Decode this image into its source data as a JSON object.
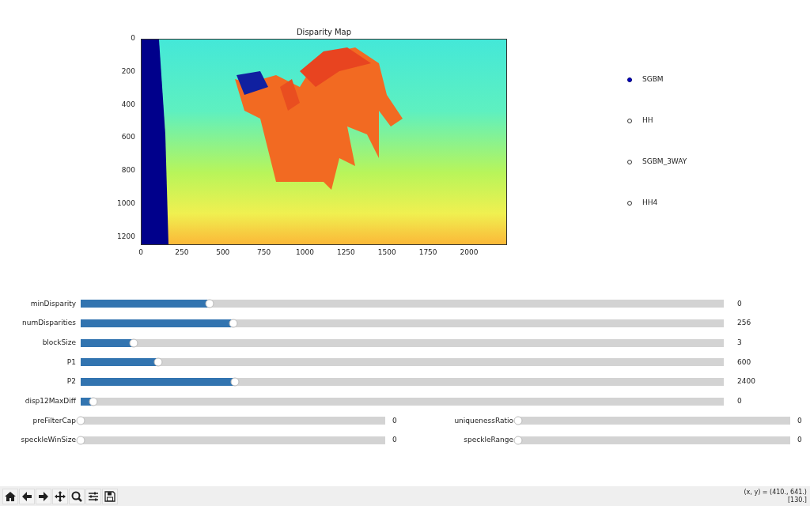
{
  "plot": {
    "title": "Disparity Map",
    "xticks": [
      "0",
      "250",
      "500",
      "750",
      "1000",
      "1250",
      "1500",
      "1750",
      "2000"
    ],
    "yticks": [
      "0",
      "200",
      "400",
      "600",
      "800",
      "1000",
      "1200"
    ]
  },
  "radio": [
    {
      "label": "SGBM",
      "selected": true
    },
    {
      "label": "HH",
      "selected": false
    },
    {
      "label": "SGBM_3WAY",
      "selected": false
    },
    {
      "label": "HH4",
      "selected": false
    }
  ],
  "slider_rows": [
    [
      {
        "label": "minDisparity",
        "value": "0",
        "level": 0.2
      }
    ],
    [
      {
        "label": "numDisparities",
        "value": "256",
        "level": 0.238
      }
    ],
    [
      {
        "label": "blockSize",
        "value": "3",
        "level": 0.083
      }
    ],
    [
      {
        "label": "P1",
        "value": "600",
        "level": 0.12
      }
    ],
    [
      {
        "label": "P2",
        "value": "2400",
        "level": 0.24
      }
    ],
    [
      {
        "label": "disp12MaxDiff",
        "value": "0",
        "level": 0.02
      }
    ],
    [
      {
        "label": "preFilterCap",
        "value": "0",
        "level": 0
      },
      {
        "label": "uniquenessRatio",
        "value": "0",
        "level": 0
      }
    ],
    [
      {
        "label": "speckleWinSize",
        "value": "0",
        "level": 0
      },
      {
        "label": "speckleRange",
        "value": "0",
        "level": 0
      }
    ]
  ],
  "toolbar": [
    {
      "kind": "home"
    },
    {
      "kind": "back"
    },
    {
      "kind": "forward"
    },
    {
      "kind": "pan"
    },
    {
      "kind": "zoom"
    },
    {
      "kind": "configure"
    },
    {
      "kind": "save"
    }
  ],
  "status": [
    "(x, y) = (410., 641.)",
    "[130.]"
  ]
}
